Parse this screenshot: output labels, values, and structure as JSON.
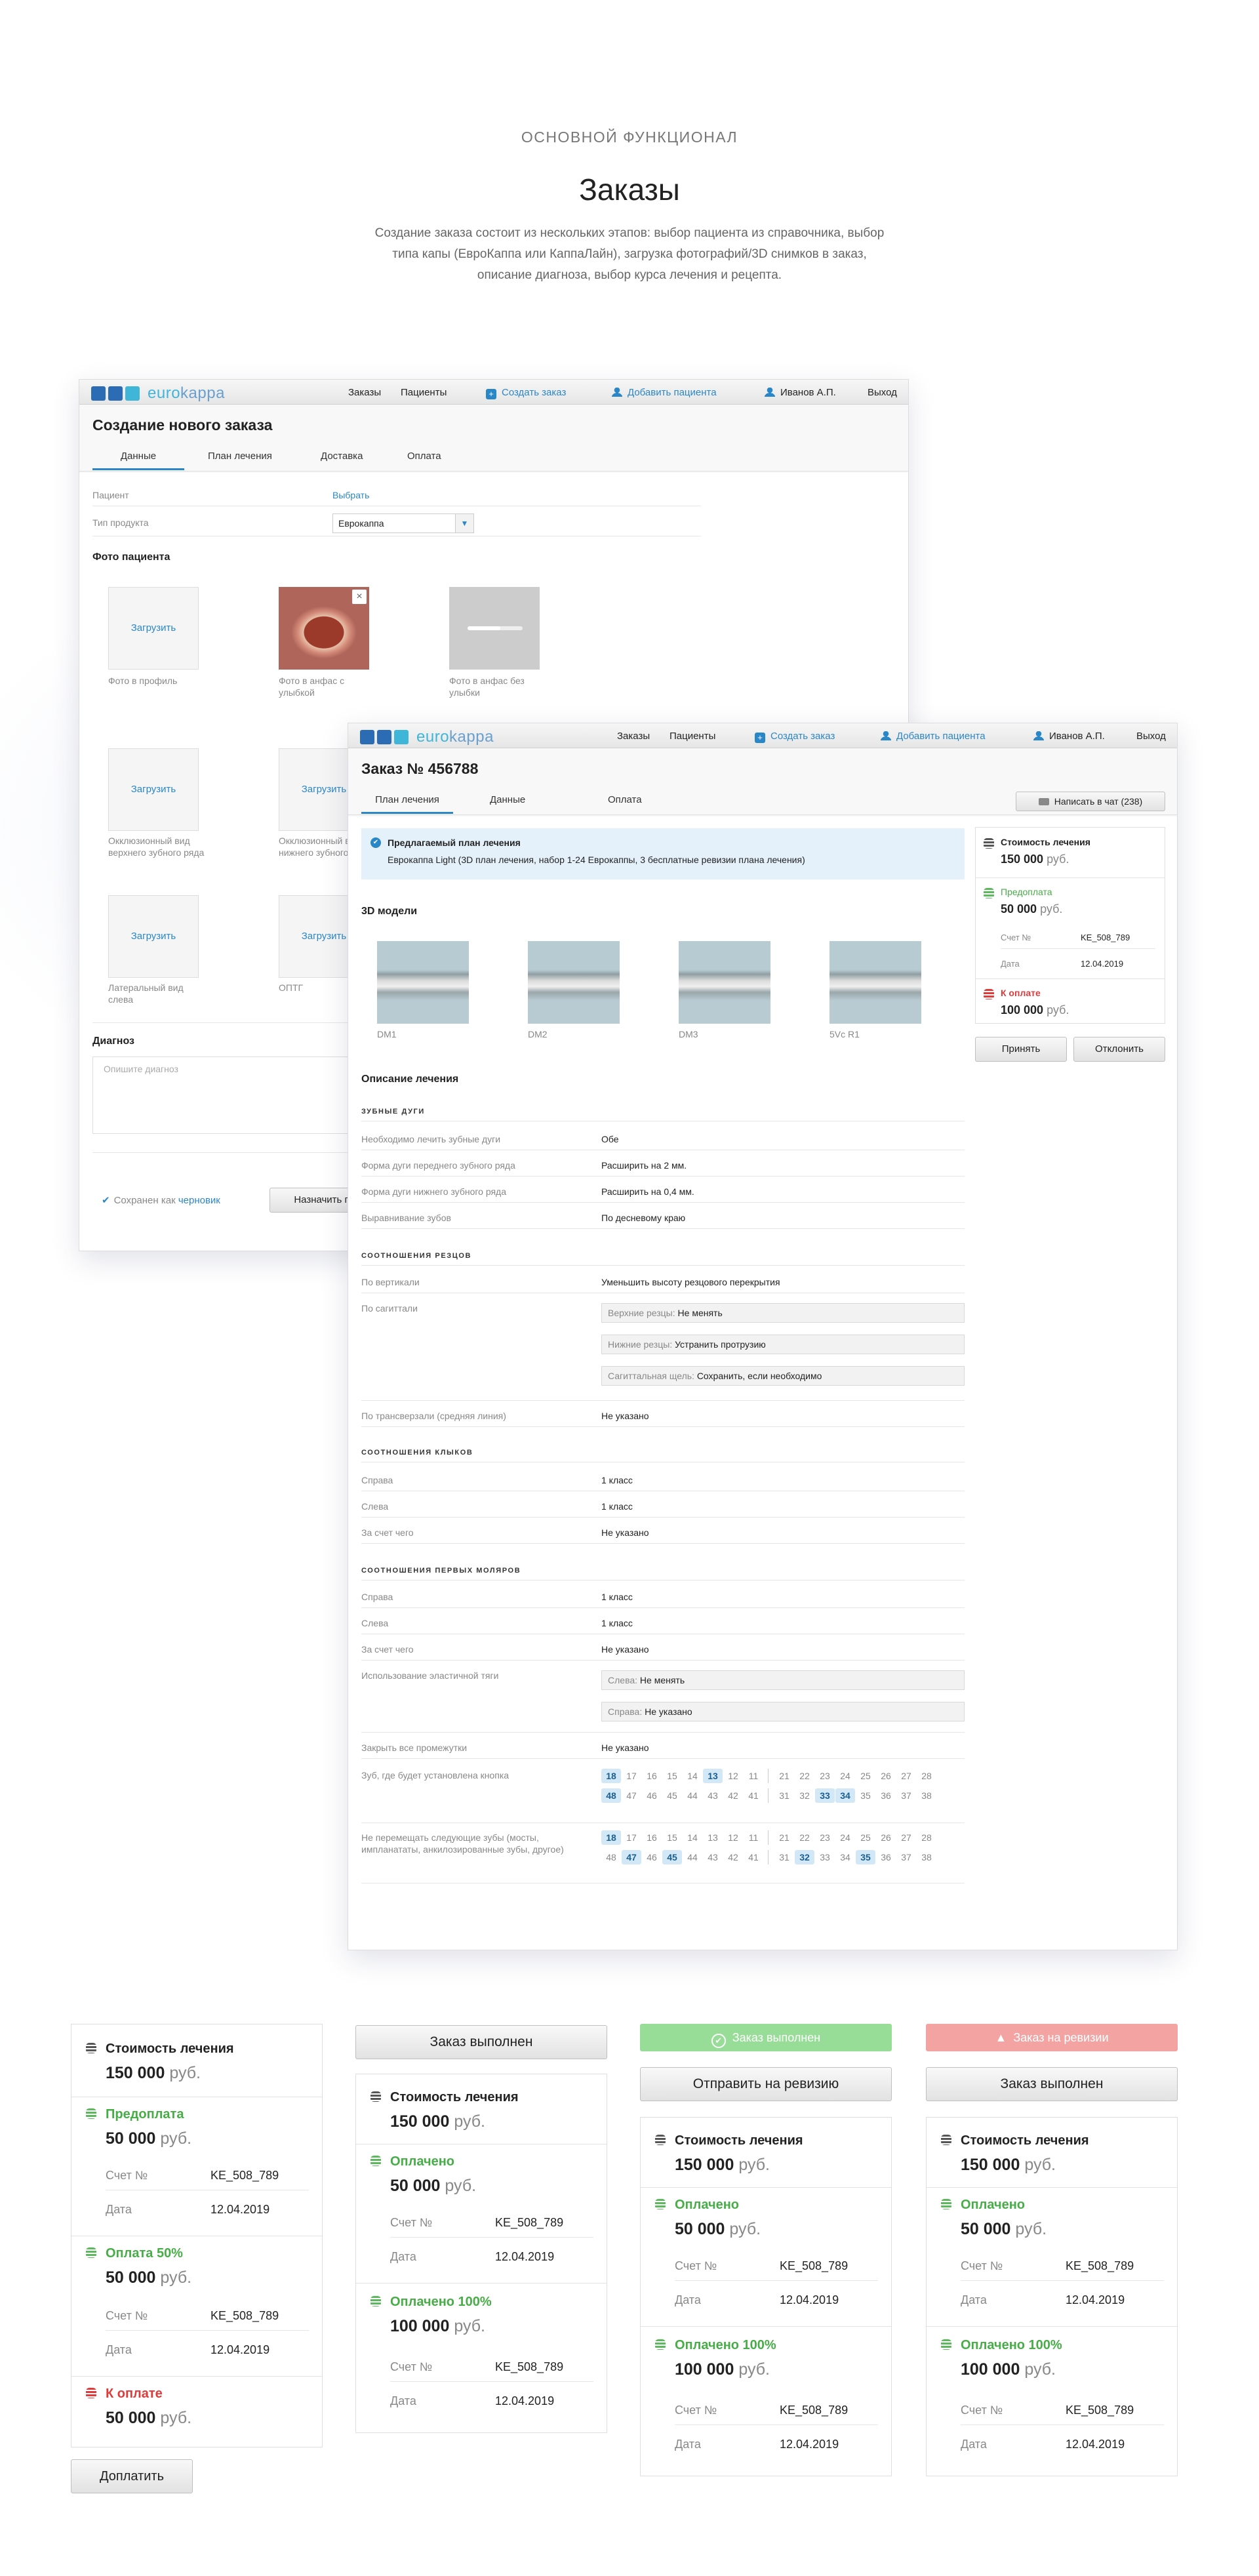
{
  "header": {
    "overline": "ОСНОВНОЙ ФУНКЦИОНАЛ",
    "title": "Заказы",
    "description": "Создание заказа состоит из нескольких этапов:  выбор пациента из справочника, выбор типа капы (ЕвроКаппа или КаппаЛайн), загрузка фотографий/3D снимков в заказ, описание диагноза, выбор курса лечения и рецепта."
  },
  "topbar": {
    "logo_text": "euro",
    "logo_text2": "kappa",
    "orders": "Заказы",
    "patients": "Пациенты",
    "create_order": "Создать заказ",
    "add_patient": "Добавить пациента",
    "user": "Иванов А.П.",
    "logout": "Выход"
  },
  "new_order": {
    "title": "Создание нового заказа",
    "tabs": [
      "Данные",
      "План лечения",
      "Доставка",
      "Оплата"
    ],
    "patient_label": "Пациент",
    "patient_action": "Выбрать",
    "product_label": "Тип продукта",
    "product_value": "Еврокаппа",
    "photos_title": "Фото пациента",
    "upload": "Загрузить",
    "photos": [
      "Фото в профиль",
      "Фото в анфас с улыбкой",
      "Фото в анфас без улыбки",
      "Окклюзионный вид верхнего зубного ряда",
      "Окклюзионный вид нижнего зубного ряда",
      "Латеральный вид слева",
      "ОПТГ"
    ],
    "diagnosis_title": "Диагноз",
    "diagnosis_placeholder": "Опишите диагноз",
    "saved_prefix": "Сохранен как",
    "saved_link": "черновик",
    "assign_btn": "Назначить п"
  },
  "order": {
    "title": "Заказ № 456788",
    "tabs": [
      "План лечения",
      "Данные",
      "Оплата"
    ],
    "chat_btn": "Написать в чат  (238)",
    "plan_title": "Предлагаемый план лечения",
    "plan_text": "Еврокаппа Light (3D план лечения, набор 1-24 Еврокаппы, 3 бесплатные ревизии плана лечения)",
    "models_title": "3D модели",
    "models": [
      "DM1",
      "DM2",
      "DM3",
      "5Vc R1"
    ],
    "desc_title": "Описание лечения",
    "arches_cap": "ЗУБНЫЕ ДУГИ",
    "arches": [
      [
        "Необходимо лечить зубные дуги",
        "Обе"
      ],
      [
        "Форма дуги переднего зубного ряда",
        "Расширить на   2 мм."
      ],
      [
        "Форма дуги нижнего зубного ряда",
        "Расширить на   0,4 мм."
      ],
      [
        "Выравнивание зубов",
        "По десневому краю"
      ]
    ],
    "incisors_cap": "СООТНОШЕНИЯ РЕЗЦОВ",
    "vertical_label": "По вертикали",
    "vertical_value": "Уменьшить высоту резцового перекрытия",
    "sagittal_label": "По сагиттали",
    "sagittal": [
      [
        "Верхние резцы:",
        "Не менять"
      ],
      [
        "Нижние резцы:",
        "Устранить протрузию"
      ],
      [
        "Сагиттальная щель:",
        "Сохранить, если необходимо"
      ]
    ],
    "transversal_label": "По трансверзали (средняя линия)",
    "transversal_value": "Не указано",
    "canines_cap": "СООТНОШЕНИЯ КЛЫКОВ",
    "canines": [
      [
        "Справа",
        "1 класс"
      ],
      [
        "Слева",
        "1 класс"
      ],
      [
        "За счет чего",
        "Не указано"
      ]
    ],
    "molars_cap": "СООТНОШЕНИЯ ПЕРВЫХ МОЛЯРОВ",
    "molars": [
      [
        "Справа",
        "1 класс"
      ],
      [
        "Слева",
        "1 класс"
      ],
      [
        "За счет чего",
        "Не указано"
      ]
    ],
    "elastic_label": "Использование эластичной тяги",
    "elastic": [
      [
        "Слева:",
        "Не менять"
      ],
      [
        "Справа:",
        "Не указано"
      ]
    ],
    "gaps_label": "Закрыть все промежутки",
    "gaps_value": "Не указано",
    "button_label": "Зуб, где будет установлена кнопка",
    "nomove_label": "Не перемещать следующие зубы (мосты, импланататы, анкилозированные зубы, другое)",
    "teeth_upper": [
      "18",
      "17",
      "16",
      "15",
      "14",
      "13",
      "12",
      "11",
      "21",
      "22",
      "23",
      "24",
      "25",
      "26",
      "27",
      "28"
    ],
    "teeth_lower": [
      "48",
      "47",
      "46",
      "45",
      "44",
      "43",
      "42",
      "41",
      "31",
      "32",
      "33",
      "34",
      "35",
      "36",
      "37",
      "38"
    ],
    "accept": "Принять",
    "reject": "Отклонить"
  },
  "pay": {
    "cost": "Стоимость лечения",
    "cost_amt": "150 000",
    "rub": "руб.",
    "prepay": "Предоплата",
    "paid": "Оплачено",
    "paid100": "Оплачено 100%",
    "half": "Оплата 50%",
    "due": "К оплате",
    "prepay_amt": "50 000",
    "full_amt": "100 000",
    "acc": "Счет №",
    "acc_val": "KE_508_789",
    "date": "Дата",
    "date_val": "12.04.2019",
    "topup": "Доплатить",
    "done": "Заказ выполнен",
    "send_rev": "Отправить на ревизию",
    "rev_banner": "Заказ на ревизии"
  },
  "colors": {
    "accent": "#2a87c7",
    "green": "#47ad47",
    "green_banner": "#97dc97",
    "red": "#e03b3b",
    "red_banner": "#f4a3a3"
  }
}
